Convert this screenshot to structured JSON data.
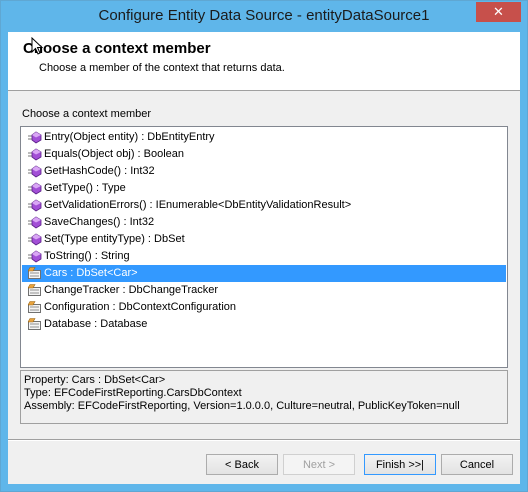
{
  "window": {
    "title": "Configure Entity Data Source - entityDataSource1",
    "close_glyph": "✕"
  },
  "header": {
    "title": "Choose a context member",
    "subtitle": "Choose a member of the context that returns data."
  },
  "list": {
    "label": "Choose a context member",
    "items": [
      {
        "text": "Entry(Object entity) : DbEntityEntry",
        "icon": "method-icon"
      },
      {
        "text": "Equals(Object obj) : Boolean",
        "icon": "method-icon"
      },
      {
        "text": "GetHashCode() : Int32",
        "icon": "method-icon"
      },
      {
        "text": "GetType() : Type",
        "icon": "method-icon"
      },
      {
        "text": "GetValidationErrors() : IEnumerable<DbEntityValidationResult>",
        "icon": "method-icon"
      },
      {
        "text": "SaveChanges() : Int32",
        "icon": "method-icon"
      },
      {
        "text": "Set(Type entityType) : DbSet",
        "icon": "method-icon"
      },
      {
        "text": "ToString() : String",
        "icon": "method-icon"
      },
      {
        "text": "Cars : DbSet<Car>",
        "icon": "property-icon",
        "selected": true
      },
      {
        "text": "ChangeTracker : DbChangeTracker",
        "icon": "property-icon"
      },
      {
        "text": "Configuration : DbContextConfiguration",
        "icon": "property-icon"
      },
      {
        "text": "Database : Database",
        "icon": "property-icon"
      }
    ]
  },
  "details": {
    "property": "Property: Cars : DbSet<Car>",
    "type": "Type: EFCodeFirstReporting.CarsDbContext",
    "assembly": "Assembly: EFCodeFirstReporting, Version=1.0.0.0, Culture=neutral, PublicKeyToken=null"
  },
  "buttons": {
    "back": "< Back",
    "next": "Next >",
    "finish": "Finish >>|",
    "cancel": "Cancel"
  },
  "colors": {
    "titlebar": "#5fb6ea",
    "selection": "#3399ff",
    "method_icon": "#a24fd6",
    "close_button": "#c7504b"
  }
}
